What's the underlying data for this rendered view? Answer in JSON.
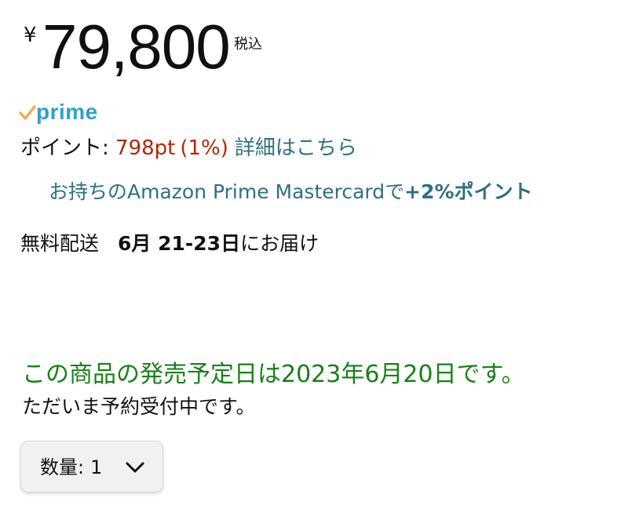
{
  "price": {
    "currency_symbol": "¥",
    "amount": "79,800",
    "tax_note": "税込"
  },
  "prime": {
    "label": "prime",
    "check_color": "#f3a847",
    "text_color": "#32a0c8"
  },
  "points": {
    "label": "ポイント: ",
    "value": "798pt",
    "percent": "(1%)",
    "details_link": "詳細はこちら"
  },
  "card_offer": {
    "text": "お持ちのAmazon Prime Mastercardで",
    "bonus": "+2%ポイント"
  },
  "delivery": {
    "label": "無料配送",
    "date": "6月 21-23日",
    "suffix": "にお届け"
  },
  "release": {
    "notice": "この商品の発売予定日は2023年6月20日です。",
    "preorder": "ただいま予約受付中です。"
  },
  "quantity": {
    "label": "数量:",
    "value": "1",
    "icon": "chevron-down-icon"
  },
  "colors": {
    "price_red": "#b12704",
    "link_teal": "#2f6f83",
    "availability_green": "#1a7f1a"
  }
}
